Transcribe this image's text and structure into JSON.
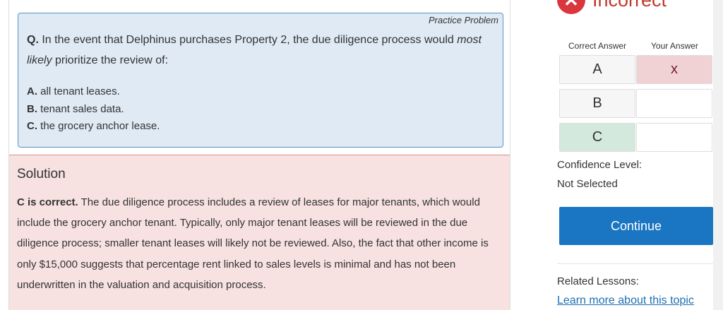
{
  "problem": {
    "label": "Practice Problem",
    "q_prefix": "Q.",
    "q_text_1": " In the event that Delphinus purchases Property 2, the due diligence process would ",
    "q_emph": "most likely",
    "q_text_2": " prioritize the review of:",
    "options": [
      {
        "letter": "A.",
        "text": " all tenant leases."
      },
      {
        "letter": "B.",
        "text": " tenant sales data."
      },
      {
        "letter": "C.",
        "text": " the grocery anchor lease."
      }
    ]
  },
  "solution": {
    "title": "Solution",
    "lead": "C is correct.",
    "body": " The due diligence process includes a review of leases for major tenants, which would include the grocery anchor tenant. Typically, only major tenant leases will be reviewed in the due diligence process; smaller tenant leases will likely not be reviewed. Also, the fact that other income is only $15,000 suggests that percentage rent linked to sales levels is minimal and has not been underwritten in the valuation and acquisition process."
  },
  "result": {
    "status": "Incorrect",
    "status_icon": "x-circle-icon",
    "header_correct": "Correct Answer",
    "header_yours": "Your Answer",
    "rows": [
      {
        "choice": "A",
        "your_mark": "x"
      },
      {
        "choice": "B",
        "your_mark": ""
      },
      {
        "choice": "C",
        "your_mark": ""
      }
    ],
    "correct_choice": "C",
    "wrong_color": "#f0d2d4",
    "correct_color": "#d4e9dd"
  },
  "confidence": {
    "label": "Confidence Level:",
    "value": "Not Selected"
  },
  "continue_label": "Continue",
  "related": {
    "label": "Related Lessons:",
    "link": "Learn more about this topic"
  },
  "colors": {
    "accent": "#1a75c2",
    "incorrect": "#d9363e",
    "question_bg": "#dfeaf5",
    "solution_bg": "#f7e1e1"
  }
}
